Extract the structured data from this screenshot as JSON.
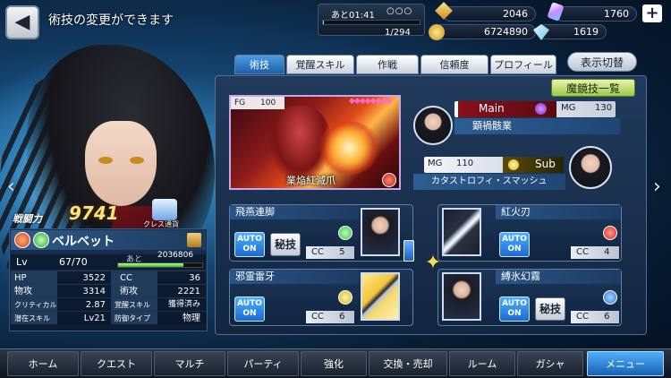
{
  "header": {
    "back_icon": "left-arrow-icon",
    "title": "術技の変更ができます"
  },
  "hud": {
    "stamina_time": "あと01:41",
    "stamina_dots": "○○○",
    "stamina_count": "1/294",
    "stamina_fraction": 0.0034,
    "gald": "2046",
    "gem": "1760",
    "coin": "6724890",
    "diamond": "1619",
    "plus_label": "+"
  },
  "tabs": [
    {
      "label": "術技",
      "active": true
    },
    {
      "label": "覚醒スキル",
      "active": false
    },
    {
      "label": "作戦",
      "active": false
    },
    {
      "label": "信頼度",
      "active": false
    },
    {
      "label": "プロフィール",
      "active": false
    }
  ],
  "toggle_label": "表示切替",
  "kyouki_label": "魔鏡技一覧",
  "featured": {
    "fg_label": "FG",
    "fg_value": "100",
    "gems": "◆◆◆◆◆◆◆◆",
    "name": "業焔紅滅爪"
  },
  "main_slot": {
    "tag": "Main",
    "mg_label": "MG",
    "mg_value": "130",
    "skill": "顕禍骸業"
  },
  "sub_slot": {
    "tag": "Sub",
    "mg_label": "MG",
    "mg_value": "110",
    "skill": "カタストロフィ・スマッシュ"
  },
  "skills": [
    {
      "name": "飛燕連脚",
      "auto": "AUTO",
      "on": "ON",
      "hiden": "秘技",
      "cc_label": "CC",
      "cc": "5",
      "element": "wind",
      "elem_color": "#33c24a"
    },
    {
      "name": "紅火刃",
      "auto": "AUTO",
      "on": "ON",
      "hiden": "",
      "cc_label": "CC",
      "cc": "4",
      "element": "fire",
      "elem_color": "#d92a2a"
    },
    {
      "name": "邪霊雷牙",
      "auto": "AUTO",
      "on": "ON",
      "hiden": "",
      "cc_label": "CC",
      "cc": "6",
      "element": "thunder",
      "elem_color": "#d8b21a"
    },
    {
      "name": "縛氷幻霧",
      "auto": "AUTO",
      "on": "ON",
      "hiden": "秘技",
      "cc_label": "CC",
      "cc": "6",
      "element": "water",
      "elem_color": "#2a7ae0"
    }
  ],
  "character": {
    "power_label": "戦闘力",
    "power_value": "9741",
    "class_label": "クレス通貨",
    "name": "ベルベット",
    "lv_label": "Lv",
    "lv_value": "67/70",
    "exp_next_label": "あと",
    "exp_next_value": "2036806",
    "exp_fraction": 0.78,
    "stats": [
      {
        "l": "HP",
        "v": "3522",
        "l2": "CC",
        "v2": "36"
      },
      {
        "l": "物攻",
        "v": "3314",
        "l2": "術攻",
        "v2": "2221"
      },
      {
        "l": "クリティカル",
        "v": "2.87",
        "l2": "覚醒スキル",
        "v2": "獲得済み"
      },
      {
        "l": "潜在スキル",
        "v": "Lv21",
        "l2": "防御タイプ",
        "v2": "物理"
      }
    ]
  },
  "nav": {
    "left": "‹",
    "right": "›"
  },
  "bottom_menu": [
    {
      "label": "ホーム",
      "active": false
    },
    {
      "label": "クエスト",
      "active": false
    },
    {
      "label": "マルチ",
      "active": false
    },
    {
      "label": "パーティ",
      "active": false
    },
    {
      "label": "強化",
      "active": false
    },
    {
      "label": "交換・売却",
      "active": false
    },
    {
      "label": "ルーム",
      "active": false
    },
    {
      "label": "ガシャ",
      "active": false
    },
    {
      "label": "メニュー",
      "active": true
    }
  ],
  "colors": {
    "accent": "#1f5fa8",
    "gold": "#ffe27a",
    "main_tag": "#8a0f1a"
  }
}
